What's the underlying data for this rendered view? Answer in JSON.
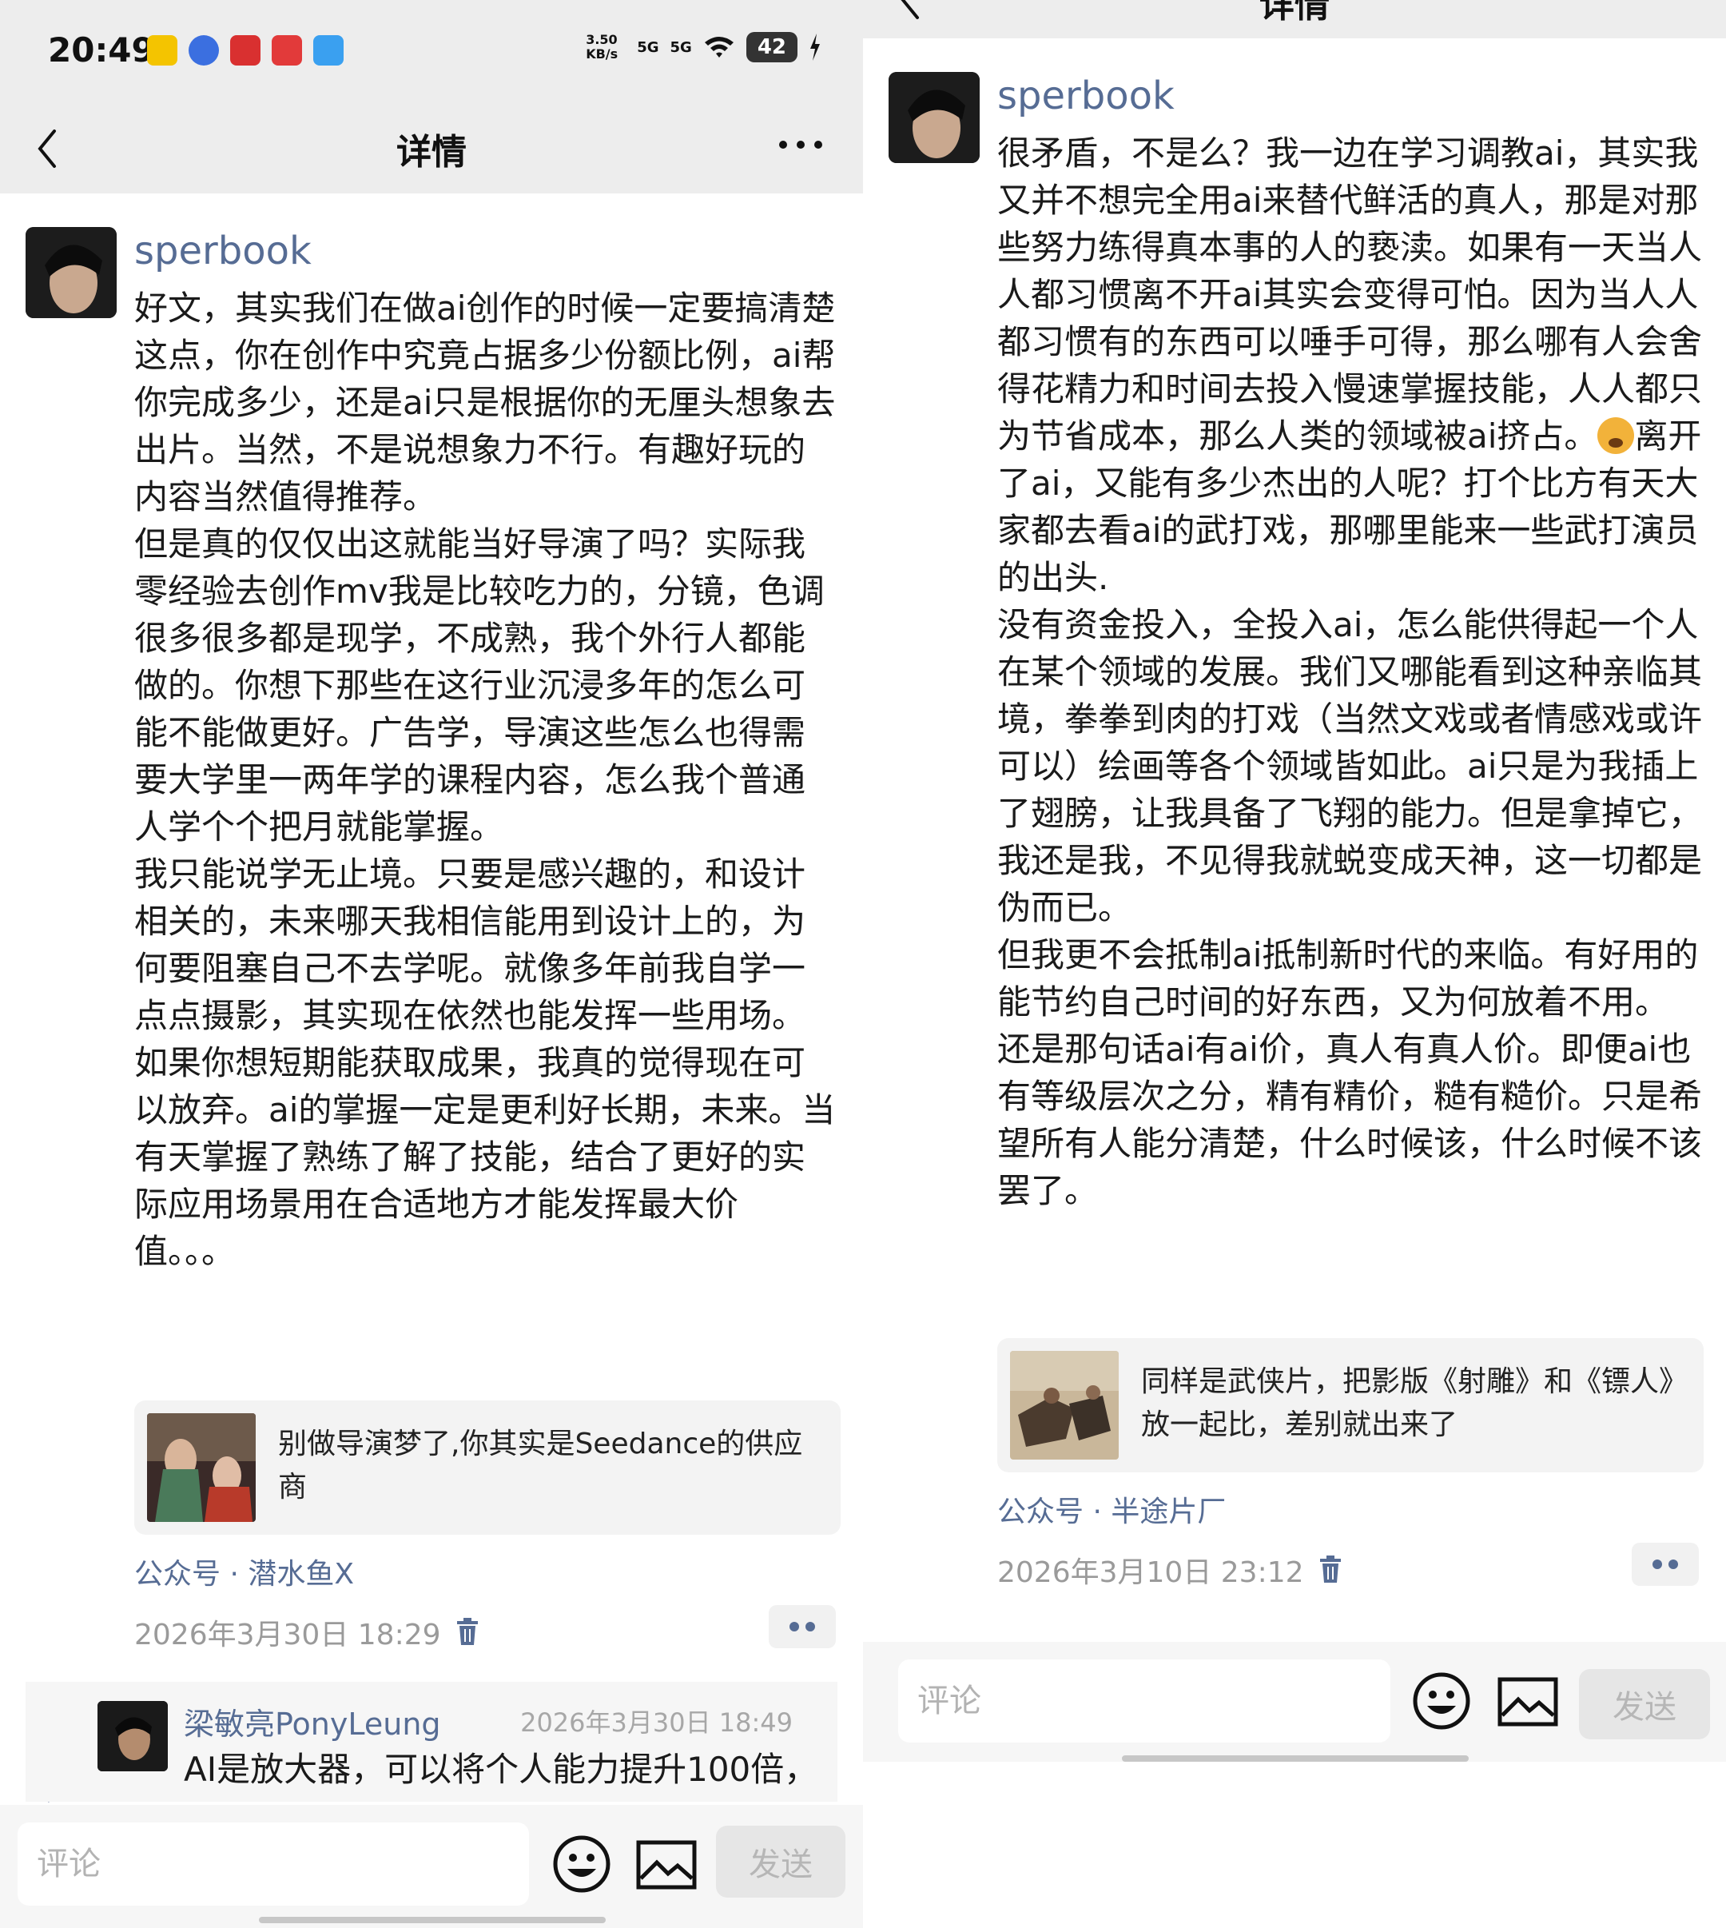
{
  "left": {
    "status": {
      "time": "20:49",
      "net_speed": "3.50 KB/s",
      "sig1": "5G",
      "sig2": "5G",
      "battery": "42"
    },
    "nav": {
      "title": "详情"
    },
    "post": {
      "author": "sperbook",
      "paragraphs": [
        "好文，其实我们在做ai创作的时候一定要搞清楚这点，你在创作中究竟占据多少份额比例，ai帮你完成多少，还是ai只是根据你的无厘头想象去出片。当然，不是说想象力不行。有趣好玩的内容当然值得推荐。",
        "但是真的仅仅出这就能当好导演了吗？实际我零经验去创作mv我是比较吃力的，分镜，色调很多很多都是现学，不成熟，我个外行人都能做的。你想下那些在这行业沉浸多年的怎么可能不能做更好。广告学，导演这些怎么也得需要大学里一两年学的课程内容，怎么我个普通人学个个把月就能掌握。",
        "我只能说学无止境。只要是感兴趣的，和设计相关的，未来哪天我相信能用到设计上的，为何要阻塞自己不去学呢。就像多年前我自学一点点摄影，其实现在依然也能发挥一些用场。",
        "如果你想短期能获取成果，我真的觉得现在可以放弃。ai的掌握一定是更利好长期，未来。当有天掌握了熟练了解了技能，结合了更好的实际应用场景用在合适地方才能发挥最大价值。。。"
      ],
      "link_title": "别做导演梦了,你其实是Seedance的供应商",
      "source": "公众号 · 潜水鱼X",
      "timestamp": "2026年3月30日 18:29"
    },
    "comment": {
      "user": "梁敏亮PonyLeung",
      "time": "2026年3月30日 18:49",
      "text": "AI是放大器，可以将个人能力提升100倍，"
    },
    "input": {
      "placeholder": "评论",
      "send_label": "发送"
    }
  },
  "right": {
    "nav": {
      "title": "详情"
    },
    "post": {
      "author": "sperbook",
      "p1_a": "很矛盾，不是么？我一边在学习调教ai，其实我又并不想完全用ai来替代鲜活的真人，那是对那些努力练得真本事的人的亵渎。如果有一天当人人都习惯离不开ai其实会变得可怕。因为当人人都习惯有的东西可以唾手可得，那么哪有人会舍得花精力和时间去投入慢速掌握技能，人人都只为节省成本，那么人类的领域被ai挤占。",
      "p1_b": "离开了ai，又能有多少杰出的人呢？打个比方有天大家都去看ai的武打戏，那哪里能来一些武打演员的出头.",
      "paragraphs": [
        "没有资金投入，全投入ai，怎么能供得起一个人在某个领域的发展。我们又哪能看到这种亲临其境，拳拳到肉的打戏（当然文戏或者情感戏或许可以）绘画等各个领域皆如此。ai只是为我插上了翅膀，让我具备了飞翔的能力。但是拿掉它，我还是我，不见得我就蜕变成天神，这一切都是伪而已。",
        "但我更不会抵制ai抵制新时代的来临。有好用的能节约自己时间的好东西，又为何放着不用。",
        "还是那句话ai有ai价，真人有真人价。即便ai也有等级层次之分，精有精价，糙有糙价。只是希望所有人能分清楚，什么时候该，什么时候不该罢了。"
      ],
      "link_title": "同样是武侠片，把影版《射雕》和《镖人》放一起比，差别就出来了",
      "source": "公众号 · 半途片厂",
      "timestamp": "2026年3月10日 23:12"
    },
    "input": {
      "placeholder": "评论",
      "send_label": "发送"
    }
  },
  "colors": {
    "link_blue": "#566c94",
    "gray_bg": "#ededed",
    "card_bg": "#f3f3f3"
  }
}
